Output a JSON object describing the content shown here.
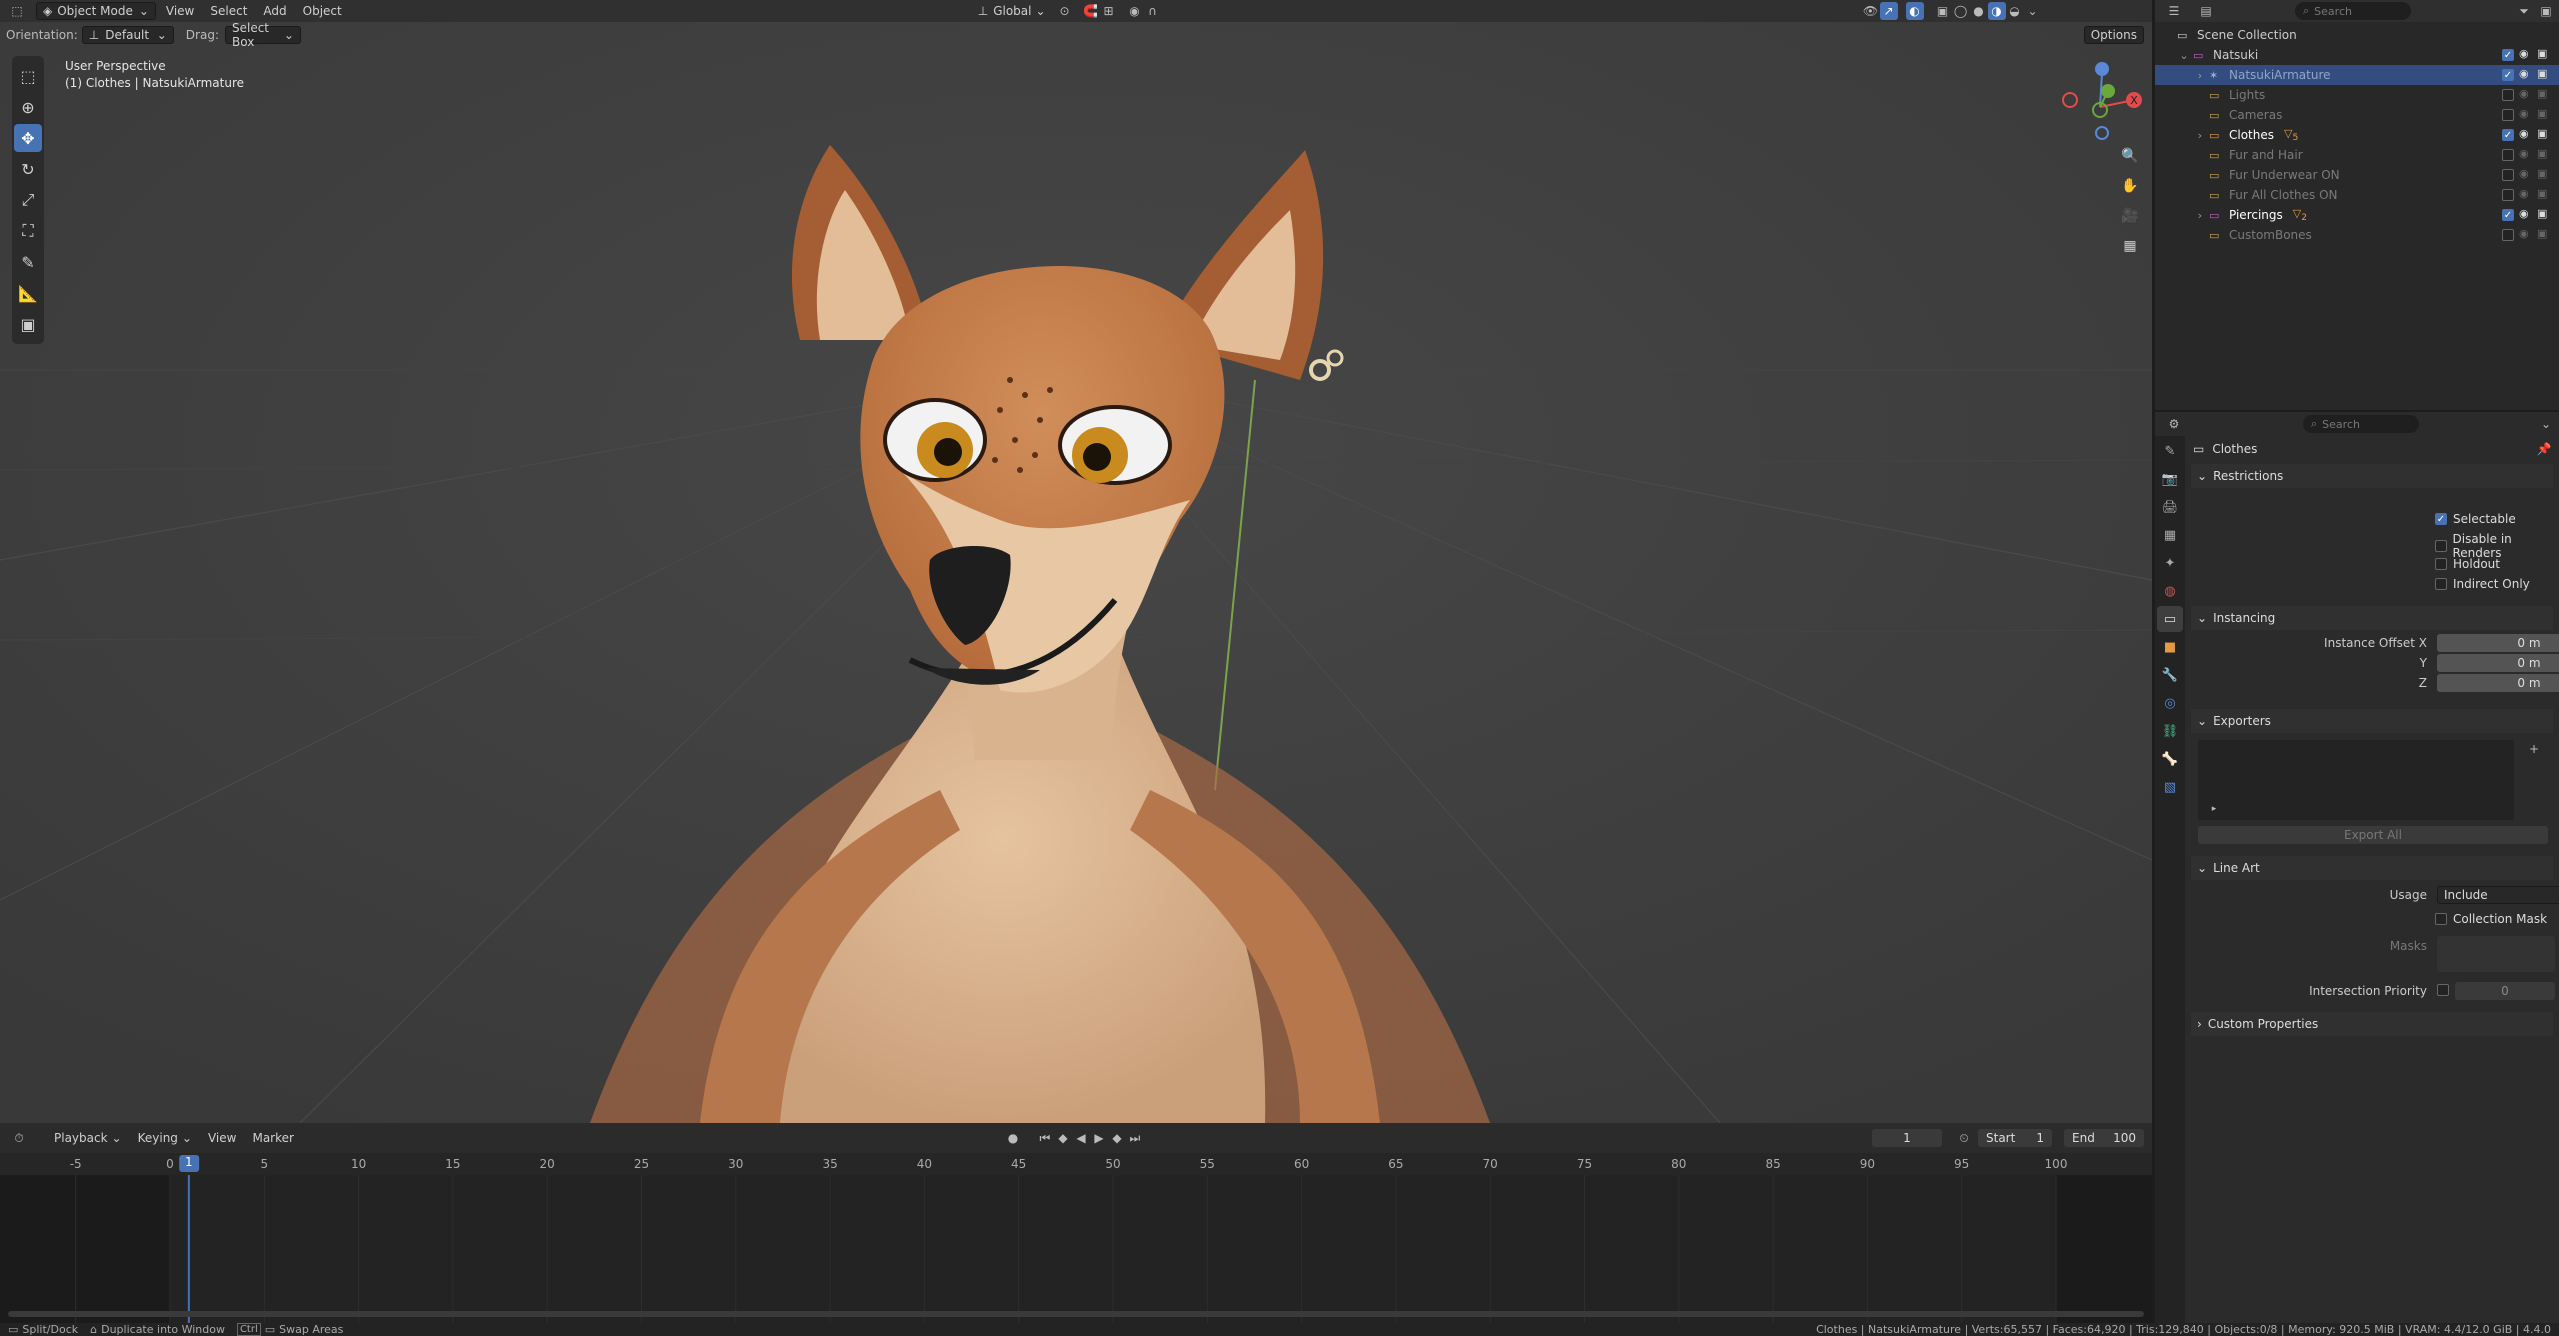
{
  "viewport": {
    "header": {
      "mode": "Object Mode",
      "menus": [
        "View",
        "Select",
        "Add",
        "Object"
      ],
      "transform_orientation": "Global"
    },
    "toolsettings": {
      "orientation_label": "Orientation:",
      "orientation_value": "Default",
      "drag_label": "Drag:",
      "drag_value": "Select Box",
      "options": "Options"
    },
    "overlay_title": "User Perspective",
    "overlay_subtitle": "(1) Clothes | NatsukiArmature",
    "tools": [
      "select-box-icon",
      "cursor-icon",
      "move-icon",
      "rotate-icon",
      "scale-icon",
      "transform-icon",
      "annotate-icon",
      "measure-icon",
      "add-cube-icon"
    ],
    "gizmo": {
      "x": "X",
      "y": "Y",
      "z": "Z"
    }
  },
  "timeline": {
    "menus": [
      "Playback",
      "Keying",
      "View",
      "Marker"
    ],
    "current_frame": "1",
    "start_label": "Start",
    "start": "1",
    "end_label": "End",
    "end": "100",
    "ticks": [
      "-5",
      "0",
      "5",
      "10",
      "15",
      "20",
      "25",
      "30",
      "35",
      "40",
      "45",
      "50",
      "55",
      "60",
      "65",
      "70",
      "75",
      "80",
      "85",
      "90",
      "95",
      "100"
    ],
    "playhead": "1"
  },
  "outliner": {
    "search_placeholder": "Search",
    "rows": [
      {
        "label": "Scene Collection",
        "indent": 0,
        "expand": "",
        "vis": false,
        "color": "#cccccc"
      },
      {
        "label": "Natsuki",
        "indent": 1,
        "expand": "⌄",
        "vis": true,
        "color": "#cccccc"
      },
      {
        "label": "NatsukiArmature",
        "indent": 2,
        "expand": "›",
        "vis": true,
        "color": "#8fa6c8",
        "selected": true
      },
      {
        "label": "Lights",
        "indent": 2,
        "expand": "",
        "vis": false,
        "color": "#7a7a7a"
      },
      {
        "label": "Cameras",
        "indent": 2,
        "expand": "",
        "vis": false,
        "color": "#7a7a7a"
      },
      {
        "label": "Clothes",
        "indent": 2,
        "expand": "›",
        "vis": true,
        "color": "#ffffff",
        "badge": "5"
      },
      {
        "label": "Fur and Hair",
        "indent": 2,
        "expand": "",
        "vis": false,
        "color": "#7a7a7a"
      },
      {
        "label": "Fur Underwear ON",
        "indent": 2,
        "expand": "",
        "vis": false,
        "color": "#7a7a7a"
      },
      {
        "label": "Fur All Clothes ON",
        "indent": 2,
        "expand": "",
        "vis": false,
        "color": "#7a7a7a"
      },
      {
        "label": "Piercings",
        "indent": 2,
        "expand": "›",
        "vis": true,
        "color": "#ffffff",
        "badge": "2"
      },
      {
        "label": "CustomBones",
        "indent": 2,
        "expand": "",
        "vis": false,
        "color": "#7a7a7a"
      }
    ]
  },
  "properties": {
    "search_placeholder": "Search",
    "title": "Clothes",
    "restrictions": {
      "header": "Restrictions",
      "selectable": "Selectable",
      "disable_renders": "Disable in Renders",
      "holdout": "Holdout",
      "indirect_only": "Indirect Only"
    },
    "instancing": {
      "header": "Instancing",
      "offset_x_label": "Instance Offset X",
      "y_label": "Y",
      "z_label": "Z",
      "x": "0 m",
      "y": "0 m",
      "z": "0 m"
    },
    "exporters": {
      "header": "Exporters",
      "export_all": "Export All"
    },
    "lineart": {
      "header": "Line Art",
      "usage_label": "Usage",
      "usage": "Include",
      "collection_mask": "Collection Mask",
      "masks_label": "Masks",
      "intersection_label": "Intersection Priority",
      "intersection_value": "0"
    },
    "custom_props": "Custom Properties"
  },
  "status": {
    "left": [
      "Split/Dock",
      "Duplicate into Window",
      "Ctrl",
      "Swap Areas"
    ],
    "right": "Clothes | NatsukiArmature | Verts:65,557 | Faces:64,920 | Tris:129,840 | Objects:0/8 | Memory: 920.5 MiB | VRAM: 4.4/12.0 GiB | 4.4.0"
  }
}
